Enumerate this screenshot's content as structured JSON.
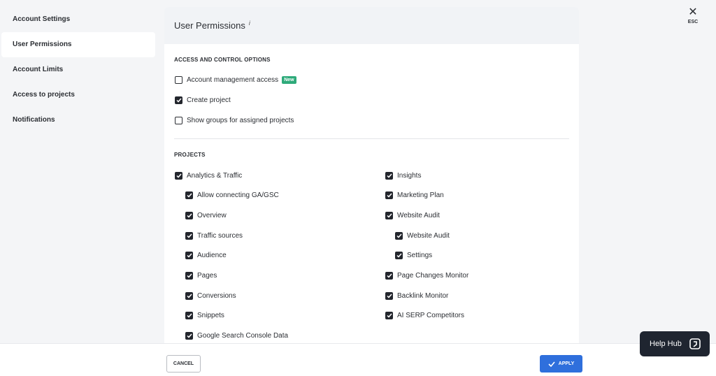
{
  "sidebar": {
    "items": [
      {
        "label": "Account Settings",
        "active": false
      },
      {
        "label": "User Permissions",
        "active": true
      },
      {
        "label": "Account Limits",
        "active": false
      },
      {
        "label": "Access to projects",
        "active": false
      },
      {
        "label": "Notifications",
        "active": false
      }
    ]
  },
  "panel": {
    "title": "User Permissions",
    "info_mark": "i"
  },
  "access": {
    "section_title": "ACCESS AND CONTROL OPTIONS",
    "options": [
      {
        "label": "Account management access",
        "checked": false,
        "badge": "New"
      },
      {
        "label": "Create project",
        "checked": true
      },
      {
        "label": "Show groups for assigned projects",
        "checked": false
      }
    ]
  },
  "projects": {
    "section_title": "PROJECTS",
    "left": [
      {
        "label": "Analytics & Traffic",
        "checked": true,
        "level": 0
      },
      {
        "label": "Allow connecting GA/GSC",
        "checked": true,
        "level": 1
      },
      {
        "label": "Overview",
        "checked": true,
        "level": 1
      },
      {
        "label": "Traffic sources",
        "checked": true,
        "level": 1
      },
      {
        "label": "Audience",
        "checked": true,
        "level": 1
      },
      {
        "label": "Pages",
        "checked": true,
        "level": 1
      },
      {
        "label": "Conversions",
        "checked": true,
        "level": 1
      },
      {
        "label": "Snippets",
        "checked": true,
        "level": 1
      },
      {
        "label": "Google Search Console Data",
        "checked": true,
        "level": 1
      }
    ],
    "right": [
      {
        "label": "Insights",
        "checked": true,
        "level": 0
      },
      {
        "label": "Marketing Plan",
        "checked": true,
        "level": 0
      },
      {
        "label": "Website Audit",
        "checked": true,
        "level": 0
      },
      {
        "label": "Website Audit",
        "checked": true,
        "level": 1
      },
      {
        "label": "Settings",
        "checked": true,
        "level": 1
      },
      {
        "label": "Page Changes Monitor",
        "checked": true,
        "level": 0
      },
      {
        "label": "Backlink Monitor",
        "checked": true,
        "level": 0
      },
      {
        "label": "AI SERP Competitors",
        "checked": true,
        "level": 0
      }
    ]
  },
  "close": {
    "esc_label": "ESC"
  },
  "footer": {
    "cancel_label": "CANCEL",
    "apply_label": "APPLY"
  },
  "helphub": {
    "label": "Help Hub"
  },
  "colors": {
    "accent": "#2f6fdc",
    "badge": "#2eaa7a",
    "checkbox": "#23262d"
  }
}
